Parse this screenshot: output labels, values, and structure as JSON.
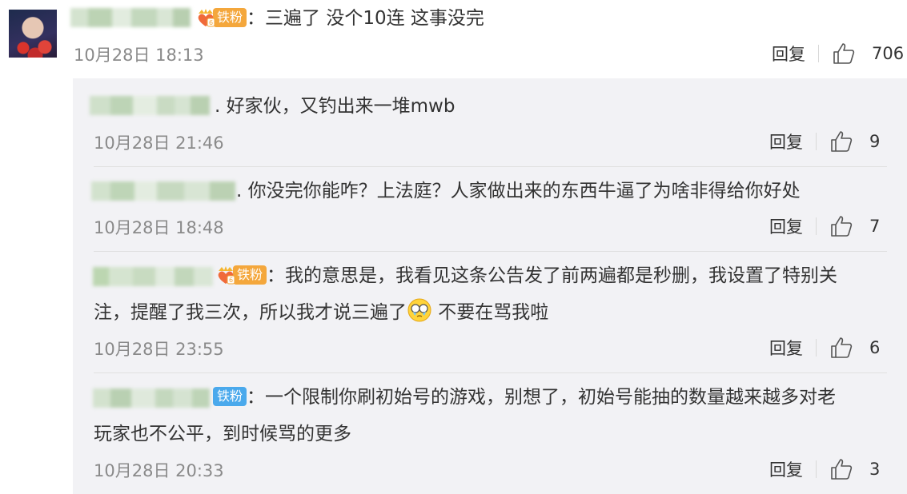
{
  "main_comment": {
    "text": "：三遍了 没个10连 这事没完",
    "date": "10月28日 18:13",
    "reply_label": "回复",
    "likes": "706",
    "badge": "铁粉"
  },
  "replies": [
    {
      "text": ". 好家伙，又钓出来一堆mwb",
      "date": "10月28日 21:46",
      "reply_label": "回复",
      "likes": "9"
    },
    {
      "text": ". 你没完你能咋？上法庭？人家做出来的东西牛逼了为啥非得给你好处",
      "date": "10月28日 18:48",
      "reply_label": "回复",
      "likes": "7"
    },
    {
      "text_line1": "：我的意思是，我看见这条公告发了前两遍都是秒删，我设置了特别关",
      "text_line2a": "注，提醒了我三次，所以我才说三遍了",
      "text_line2b": " 不要在骂我啦",
      "badge": "铁粉",
      "date": "10月28日 23:55",
      "reply_label": "回复",
      "likes": "6"
    },
    {
      "text_line1": "：一个限制你刷初始号的游戏，别想了，初始号能抽的数量越来越多对老",
      "text_line2": "玩家也不公平，到时候骂的更多",
      "badge": "铁粉",
      "date": "10月28日 20:33",
      "reply_label": "回复",
      "likes": "3"
    }
  ],
  "colors": {
    "badge_orange": "#f4a73c",
    "badge_blue": "#4aa9ec",
    "reply_bg": "#f2f2f5",
    "date_gray": "#8a8a8a"
  }
}
